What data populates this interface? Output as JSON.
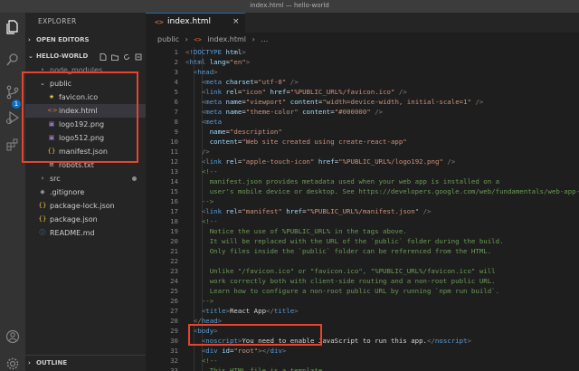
{
  "window": {
    "title": "index.html — hello-world"
  },
  "sidebar": {
    "header": "EXPLORER",
    "open_editors": "OPEN EDITORS",
    "project": "HELLO-WORLD",
    "outline": "OUTLINE",
    "items": [
      {
        "label": "node_modules",
        "icon": "›",
        "name": "folder-node-modules"
      },
      {
        "label": "public",
        "icon": "⌄",
        "name": "folder-public"
      },
      {
        "label": "favicon.ico",
        "icon": "★",
        "name": "file-favicon"
      },
      {
        "label": "index.html",
        "icon": "<>",
        "name": "file-index-html"
      },
      {
        "label": "logo192.png",
        "icon": "▣",
        "name": "file-logo192"
      },
      {
        "label": "logo512.png",
        "icon": "▣",
        "name": "file-logo512"
      },
      {
        "label": "manifest.json",
        "icon": "{}",
        "name": "file-manifest"
      },
      {
        "label": "robots.txt",
        "icon": "≡",
        "name": "file-robots"
      },
      {
        "label": "src",
        "icon": "›",
        "name": "folder-src"
      },
      {
        "label": ".gitignore",
        "icon": "◆",
        "name": "file-gitignore"
      },
      {
        "label": "package-lock.json",
        "icon": "{}",
        "name": "file-package-lock"
      },
      {
        "label": "package.json",
        "icon": "{}",
        "name": "file-package"
      },
      {
        "label": "README.md",
        "icon": "ⓘ",
        "name": "file-readme"
      }
    ]
  },
  "activity": {
    "scm_badge": "1"
  },
  "editor": {
    "tab_icon": "<>",
    "tab_label": "index.html",
    "tab_close": "×",
    "breadcrumb": {
      "folder": "public",
      "sep1": "›",
      "icon": "<>",
      "file": "index.html",
      "sep2": "›",
      "symbol": "…"
    }
  },
  "colors": {
    "accent": "#0e70c0",
    "highlight_box": "#e8432d",
    "sidebar_bg": "#252526",
    "editor_bg": "#1e1e1e"
  }
}
